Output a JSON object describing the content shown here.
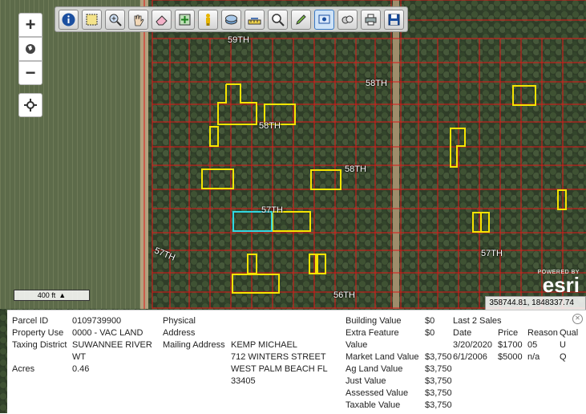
{
  "map": {
    "road_labels": [
      "59TH",
      "58TH",
      "58TH",
      "58TH",
      "57TH",
      "57TH",
      "57TH",
      "56TH"
    ],
    "scale_label": "400 ft",
    "attribution_top": "POWERED BY",
    "attribution_logo": "esri",
    "coordinates": "358744.81, 1848337.74",
    "parcel_line_color": "#e01818",
    "highlight_color": "#f5e400",
    "selected_color": "#31d6e0"
  },
  "toolbar": {
    "tools": [
      {
        "name": "info-icon"
      },
      {
        "name": "select-area-icon"
      },
      {
        "name": "zoom-in-tool-icon"
      },
      {
        "name": "pan-hand-icon"
      },
      {
        "name": "eraser-icon"
      },
      {
        "name": "add-layer-icon"
      },
      {
        "name": "street-view-person-icon"
      },
      {
        "name": "layers-icon"
      },
      {
        "name": "measure-icon"
      },
      {
        "name": "search-tool-icon"
      },
      {
        "name": "draw-pencil-icon"
      },
      {
        "name": "identify-icon"
      },
      {
        "name": "buffer-icon"
      },
      {
        "name": "print-icon"
      },
      {
        "name": "save-icon"
      }
    ]
  },
  "zoom": {
    "plus": "+",
    "minus": "−"
  },
  "parcel": {
    "parcel_id_label": "Parcel ID",
    "parcel_id": "0109739900",
    "property_use_label": "Property Use",
    "property_use": "0000 - VAC LAND",
    "taxing_district_label": "Taxing District",
    "taxing_district_1": "SUWANNEE RIVER",
    "taxing_district_2": "WT",
    "acres_label": "Acres",
    "acres": "0.46",
    "physical_label": "Physical",
    "address_label": "Address",
    "mailing_label": "Mailing Address",
    "mailing_1": "KEMP MICHAEL",
    "mailing_2": "712 WINTERS STREET",
    "mailing_3": "WEST PALM BEACH FL",
    "mailing_4": "33405",
    "building_value_label": "Building Value",
    "building_value": "$0",
    "extra_feature_label": "Extra Feature",
    "extra_feature": "$0",
    "value_label": "Value",
    "market_land_label": "Market Land Value",
    "market_land": "$3,750",
    "ag_land_label": "Ag Land Value",
    "ag_land": "$3,750",
    "just_value_label": "Just Value",
    "just_value": "$3,750",
    "assessed_label": "Assessed Value",
    "assessed": "$3,750",
    "taxable_label": "Taxable Value",
    "taxable": "$3,750"
  },
  "sales": {
    "title": "Last 2 Sales",
    "headers": [
      "Date",
      "Price",
      "Reason",
      "Qual"
    ],
    "rows": [
      [
        "3/20/2020",
        "$1700",
        "05",
        "U"
      ],
      [
        "6/1/2006",
        "$5000",
        "n/a",
        "Q"
      ]
    ]
  }
}
